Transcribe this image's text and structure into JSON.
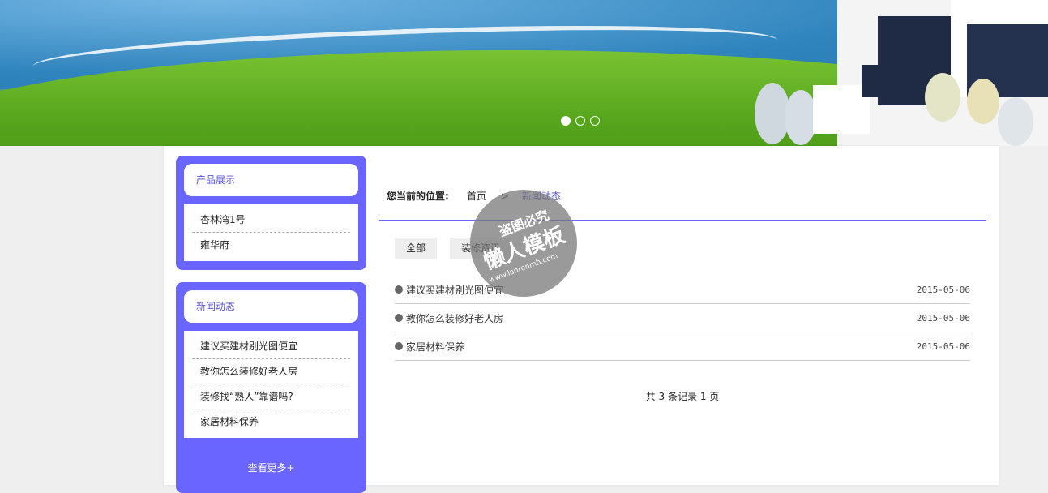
{
  "banner": {
    "dots": [
      {
        "active": true
      },
      {
        "active": false
      },
      {
        "active": false
      }
    ]
  },
  "sidebar": {
    "products": {
      "title": "产品展示",
      "items": [
        "杏林湾1号",
        "雍华府"
      ]
    },
    "news": {
      "title": "新闻动态",
      "items": [
        "建议买建材别光图便宜",
        "教你怎么装修好老人房",
        "装修找“熟人”靠谱吗?",
        "家居材料保养"
      ],
      "more": "查看更多+"
    }
  },
  "breadcrumb": {
    "label": "您当前的位置:",
    "home": "首页",
    "separator": ">",
    "current": "新闻动态"
  },
  "tabs": [
    "全部",
    "装修资讯"
  ],
  "news_list": [
    {
      "title": "建议买建材别光图便宜",
      "date": "2015-05-06"
    },
    {
      "title": "教你怎么装修好老人房",
      "date": "2015-05-06"
    },
    {
      "title": "家居材料保养",
      "date": "2015-05-06"
    }
  ],
  "pager": "共 3 条记录 1 页",
  "watermark": {
    "line1": "盗图必究",
    "line2": "懒人模板",
    "line3": "www.lanrenmb.com"
  }
}
